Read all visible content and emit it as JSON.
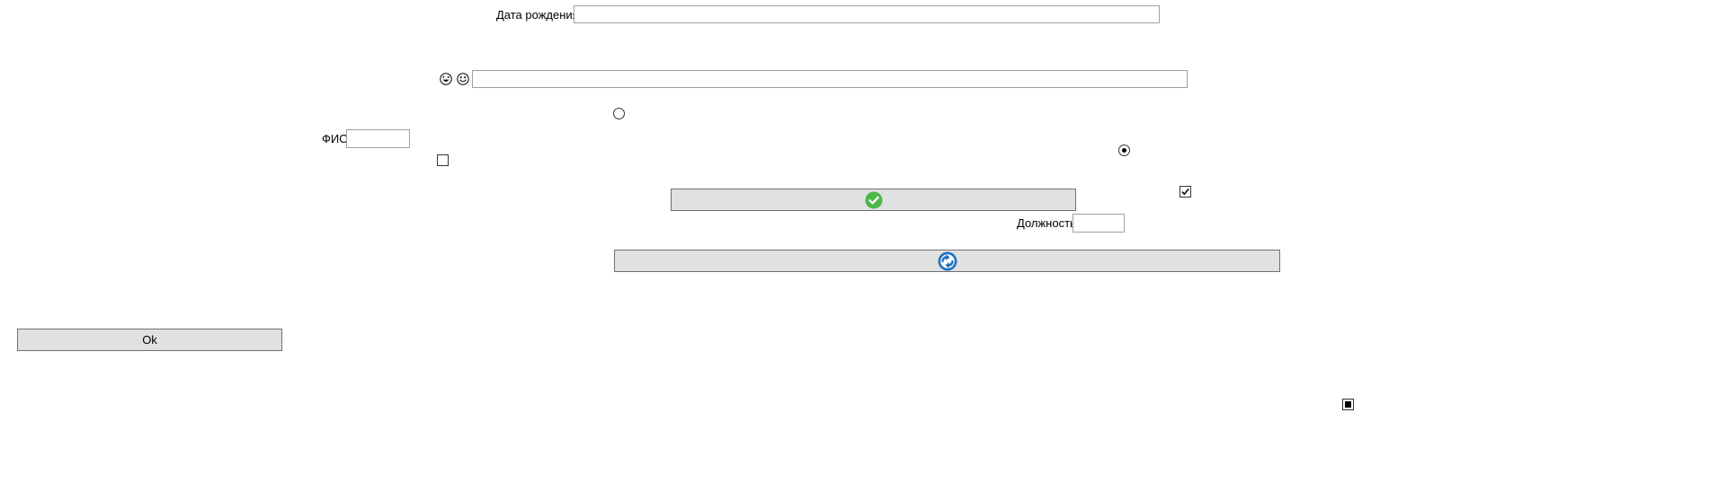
{
  "fields": {
    "birth_date": {
      "label": "Дата рождения",
      "value": ""
    },
    "emoji_field": {
      "value": ""
    },
    "fio": {
      "label": "ФИО",
      "value": ""
    },
    "position": {
      "label": "Должность",
      "value": ""
    }
  },
  "radios": {
    "radio_1": {
      "checked": false
    },
    "radio_2": {
      "checked": true
    }
  },
  "checkboxes": {
    "checkbox_1": {
      "state": "unchecked"
    },
    "checkbox_2": {
      "state": "checked"
    },
    "checkbox_3": {
      "state": "indeterminate"
    }
  },
  "buttons": {
    "confirm_button": {
      "icon": "green-check-icon",
      "label": ""
    },
    "blue_icon_button": {
      "icon": "blue-circle-arrow-icon",
      "label": ""
    },
    "ok_button": {
      "label": "Ok"
    }
  },
  "icons": {
    "emoji_1": "laughing-face-icon",
    "emoji_2": "smiling-face-icon"
  },
  "colors": {
    "button_bg": "#e1e1e1",
    "button_border": "#707070",
    "input_border": "#a0a0a0",
    "accent_green": "#4cb848",
    "accent_blue": "#1e73be"
  }
}
